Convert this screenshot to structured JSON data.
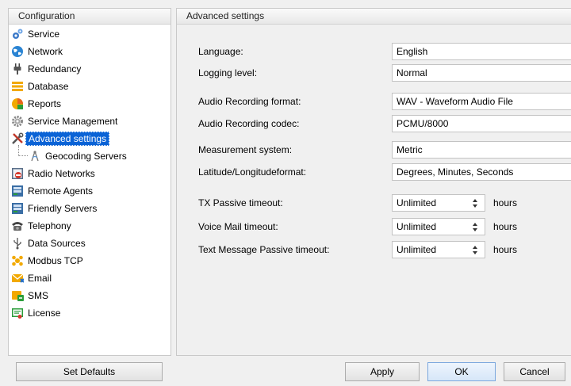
{
  "left_panel": {
    "header": "Configuration",
    "items": [
      {
        "label": "Service",
        "icon": "gears-icon"
      },
      {
        "label": "Network",
        "icon": "globe-icon"
      },
      {
        "label": "Redundancy",
        "icon": "plug-icon"
      },
      {
        "label": "Database",
        "icon": "database-icon"
      },
      {
        "label": "Reports",
        "icon": "reports-icon"
      },
      {
        "label": "Service Management",
        "icon": "gear-icon"
      },
      {
        "label": "Advanced settings",
        "icon": "tools-icon"
      },
      {
        "label": "Geocoding Servers",
        "icon": "compass-icon"
      },
      {
        "label": "Radio Networks",
        "icon": "radio-networks-icon"
      },
      {
        "label": "Remote Agents",
        "icon": "server-icon"
      },
      {
        "label": "Friendly Servers",
        "icon": "server-icon"
      },
      {
        "label": "Telephony",
        "icon": "telephone-icon"
      },
      {
        "label": "Data Sources",
        "icon": "usb-icon"
      },
      {
        "label": "Modbus TCP",
        "icon": "modbus-icon"
      },
      {
        "label": "Email",
        "icon": "email-icon"
      },
      {
        "label": "SMS",
        "icon": "sms-icon"
      },
      {
        "label": "License",
        "icon": "license-icon"
      }
    ],
    "selected": "Advanced settings"
  },
  "right_panel": {
    "header": "Advanced settings",
    "fields": {
      "language": {
        "label": "Language:",
        "value": "English"
      },
      "logging_level": {
        "label": "Logging level:",
        "value": "Normal"
      },
      "audio_format": {
        "label": "Audio Recording format:",
        "value": "WAV - Waveform Audio File"
      },
      "audio_codec": {
        "label": "Audio Recording codec:",
        "value": "PCMU/8000"
      },
      "measurement": {
        "label": "Measurement system:",
        "value": "Metric"
      },
      "latlon_format": {
        "label": "Latitude/Longitudeformat:",
        "value": "Degrees, Minutes, Seconds"
      },
      "tx_timeout": {
        "label": "TX Passive timeout:",
        "value": "Unlimited",
        "unit": "hours"
      },
      "voicemail_timeout": {
        "label": "Voice Mail timeout:",
        "value": "Unlimited",
        "unit": "hours"
      },
      "text_timeout": {
        "label": "Text Message Passive timeout:",
        "value": "Unlimited",
        "unit": "hours"
      }
    }
  },
  "buttons": {
    "set_defaults": "Set Defaults",
    "apply": "Apply",
    "ok": "OK",
    "cancel": "Cancel"
  },
  "colors": {
    "selection": "#0a63d6",
    "panel_border": "#c9c9c9",
    "background": "#f0f0f0"
  }
}
